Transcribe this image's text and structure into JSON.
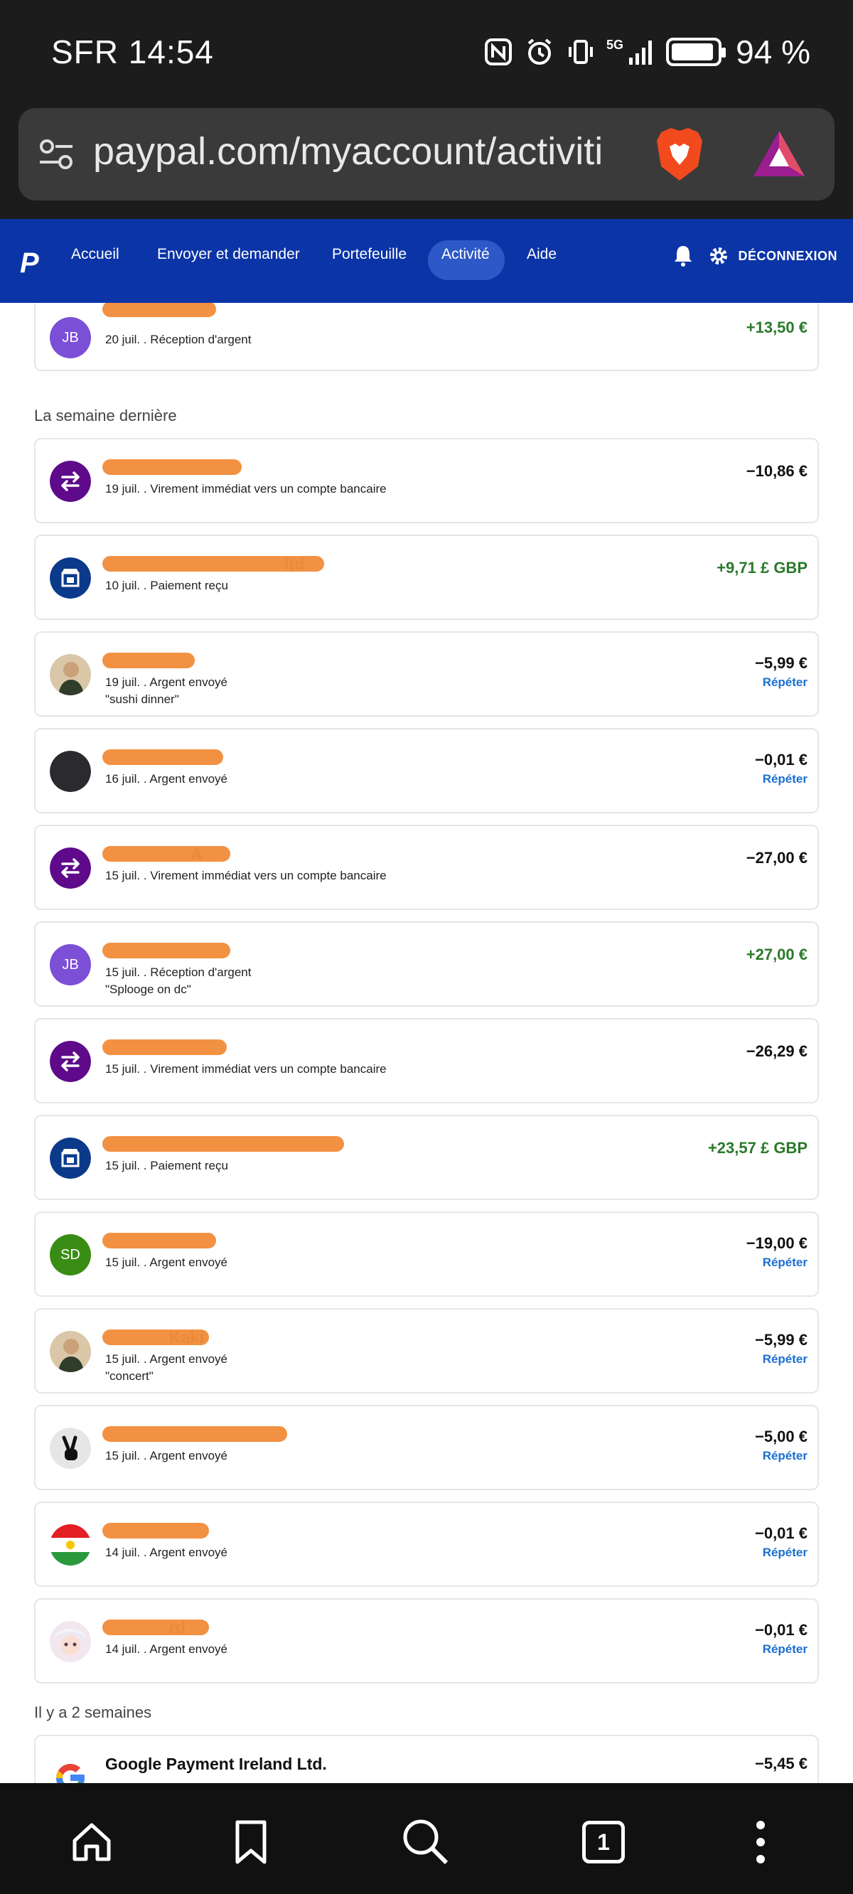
{
  "status_bar": {
    "carrier_time": "SFR 14:54",
    "network": "5G",
    "battery": "94 %",
    "battery_level": 0.94
  },
  "browser": {
    "url": "paypal.com/myaccount/activiti"
  },
  "nav": {
    "logo": "P",
    "items": [
      "Accueil",
      "Envoyer et demander",
      "Portefeuille",
      "Activité",
      "Aide"
    ],
    "active": "Activité",
    "logout": "DÉCONNEXION"
  },
  "top_card": {
    "initials": "JB",
    "date": "20 juil. . Réception d'argent",
    "amount": "+13,50 €"
  },
  "sections": [
    {
      "label": "La semaine dernière"
    },
    {
      "label": "Il y a 2 semaines"
    }
  ],
  "transactions": [
    {
      "avatar": "transfer",
      "name": "",
      "sub": "19 juil. . Virement immédiat vers un compte bancaire",
      "note": "",
      "amount": "−10,86 €",
      "positive": false,
      "repeat": ""
    },
    {
      "avatar": "store",
      "name": "ltd",
      "sub": "10 juil. . Paiement reçu",
      "note": "",
      "amount": "+9,71 £ GBP",
      "positive": true,
      "repeat": ""
    },
    {
      "avatar": "photo",
      "name": "",
      "sub": "19 juil. . Argent envoyé",
      "note": "\"sushi dinner\"",
      "amount": "−5,99 €",
      "positive": false,
      "repeat": "Répéter"
    },
    {
      "avatar": "dark",
      "name": "",
      "sub": "16 juil. . Argent envoyé",
      "note": "",
      "amount": "−0,01 €",
      "positive": false,
      "repeat": "Répéter"
    },
    {
      "avatar": "transfer",
      "name": "A",
      "sub": "15 juil. . Virement immédiat vers un compte bancaire",
      "note": "",
      "amount": "−27,00 €",
      "positive": false,
      "repeat": ""
    },
    {
      "avatar": "JB",
      "name": "",
      "sub": "15 juil. . Réception d'argent",
      "note": "\"Splooge on dc\"",
      "amount": "+27,00 €",
      "positive": true,
      "repeat": ""
    },
    {
      "avatar": "transfer",
      "name": "",
      "sub": "15 juil. . Virement immédiat vers un compte bancaire",
      "note": "",
      "amount": "−26,29 €",
      "positive": false,
      "repeat": ""
    },
    {
      "avatar": "store",
      "name": "",
      "sub": "15 juil. . Paiement reçu",
      "note": "",
      "amount": "+23,57 £ GBP",
      "positive": true,
      "repeat": ""
    },
    {
      "avatar": "SD",
      "name": "",
      "sub": "15 juil. . Argent envoyé",
      "note": "",
      "amount": "−19,00 €",
      "positive": false,
      "repeat": "Répéter"
    },
    {
      "avatar": "photo",
      "name": "Kaki",
      "sub": "15 juil. . Argent envoyé",
      "note": "\"concert\"",
      "amount": "−5,99 €",
      "positive": false,
      "repeat": "Répéter"
    },
    {
      "avatar": "peace",
      "name": "",
      "sub": "15 juil. . Argent envoyé",
      "note": "",
      "amount": "−5,00 €",
      "positive": false,
      "repeat": "Répéter"
    },
    {
      "avatar": "flag",
      "name": "",
      "sub": "14 juil. . Argent envoyé",
      "note": "",
      "amount": "−0,01 €",
      "positive": false,
      "repeat": "Répéter"
    },
    {
      "avatar": "anime",
      "name": "rd",
      "sub": "14 juil. . Argent envoyé",
      "note": "",
      "amount": "−0,01 €",
      "positive": false,
      "repeat": "Répéter"
    }
  ],
  "last_card": {
    "name": "Google Payment Ireland Ltd.",
    "amount": "−5,45 €"
  },
  "bottom_nav": {
    "tab_count": "1"
  },
  "colors": {
    "paypal_blue": "#0b34a7",
    "positive": "#2a7a2a",
    "link": "#1a6fd1",
    "transfer_icon": "#5e0a8a",
    "store_icon": "#0b3a8a",
    "redaction": "#f28d3c"
  }
}
